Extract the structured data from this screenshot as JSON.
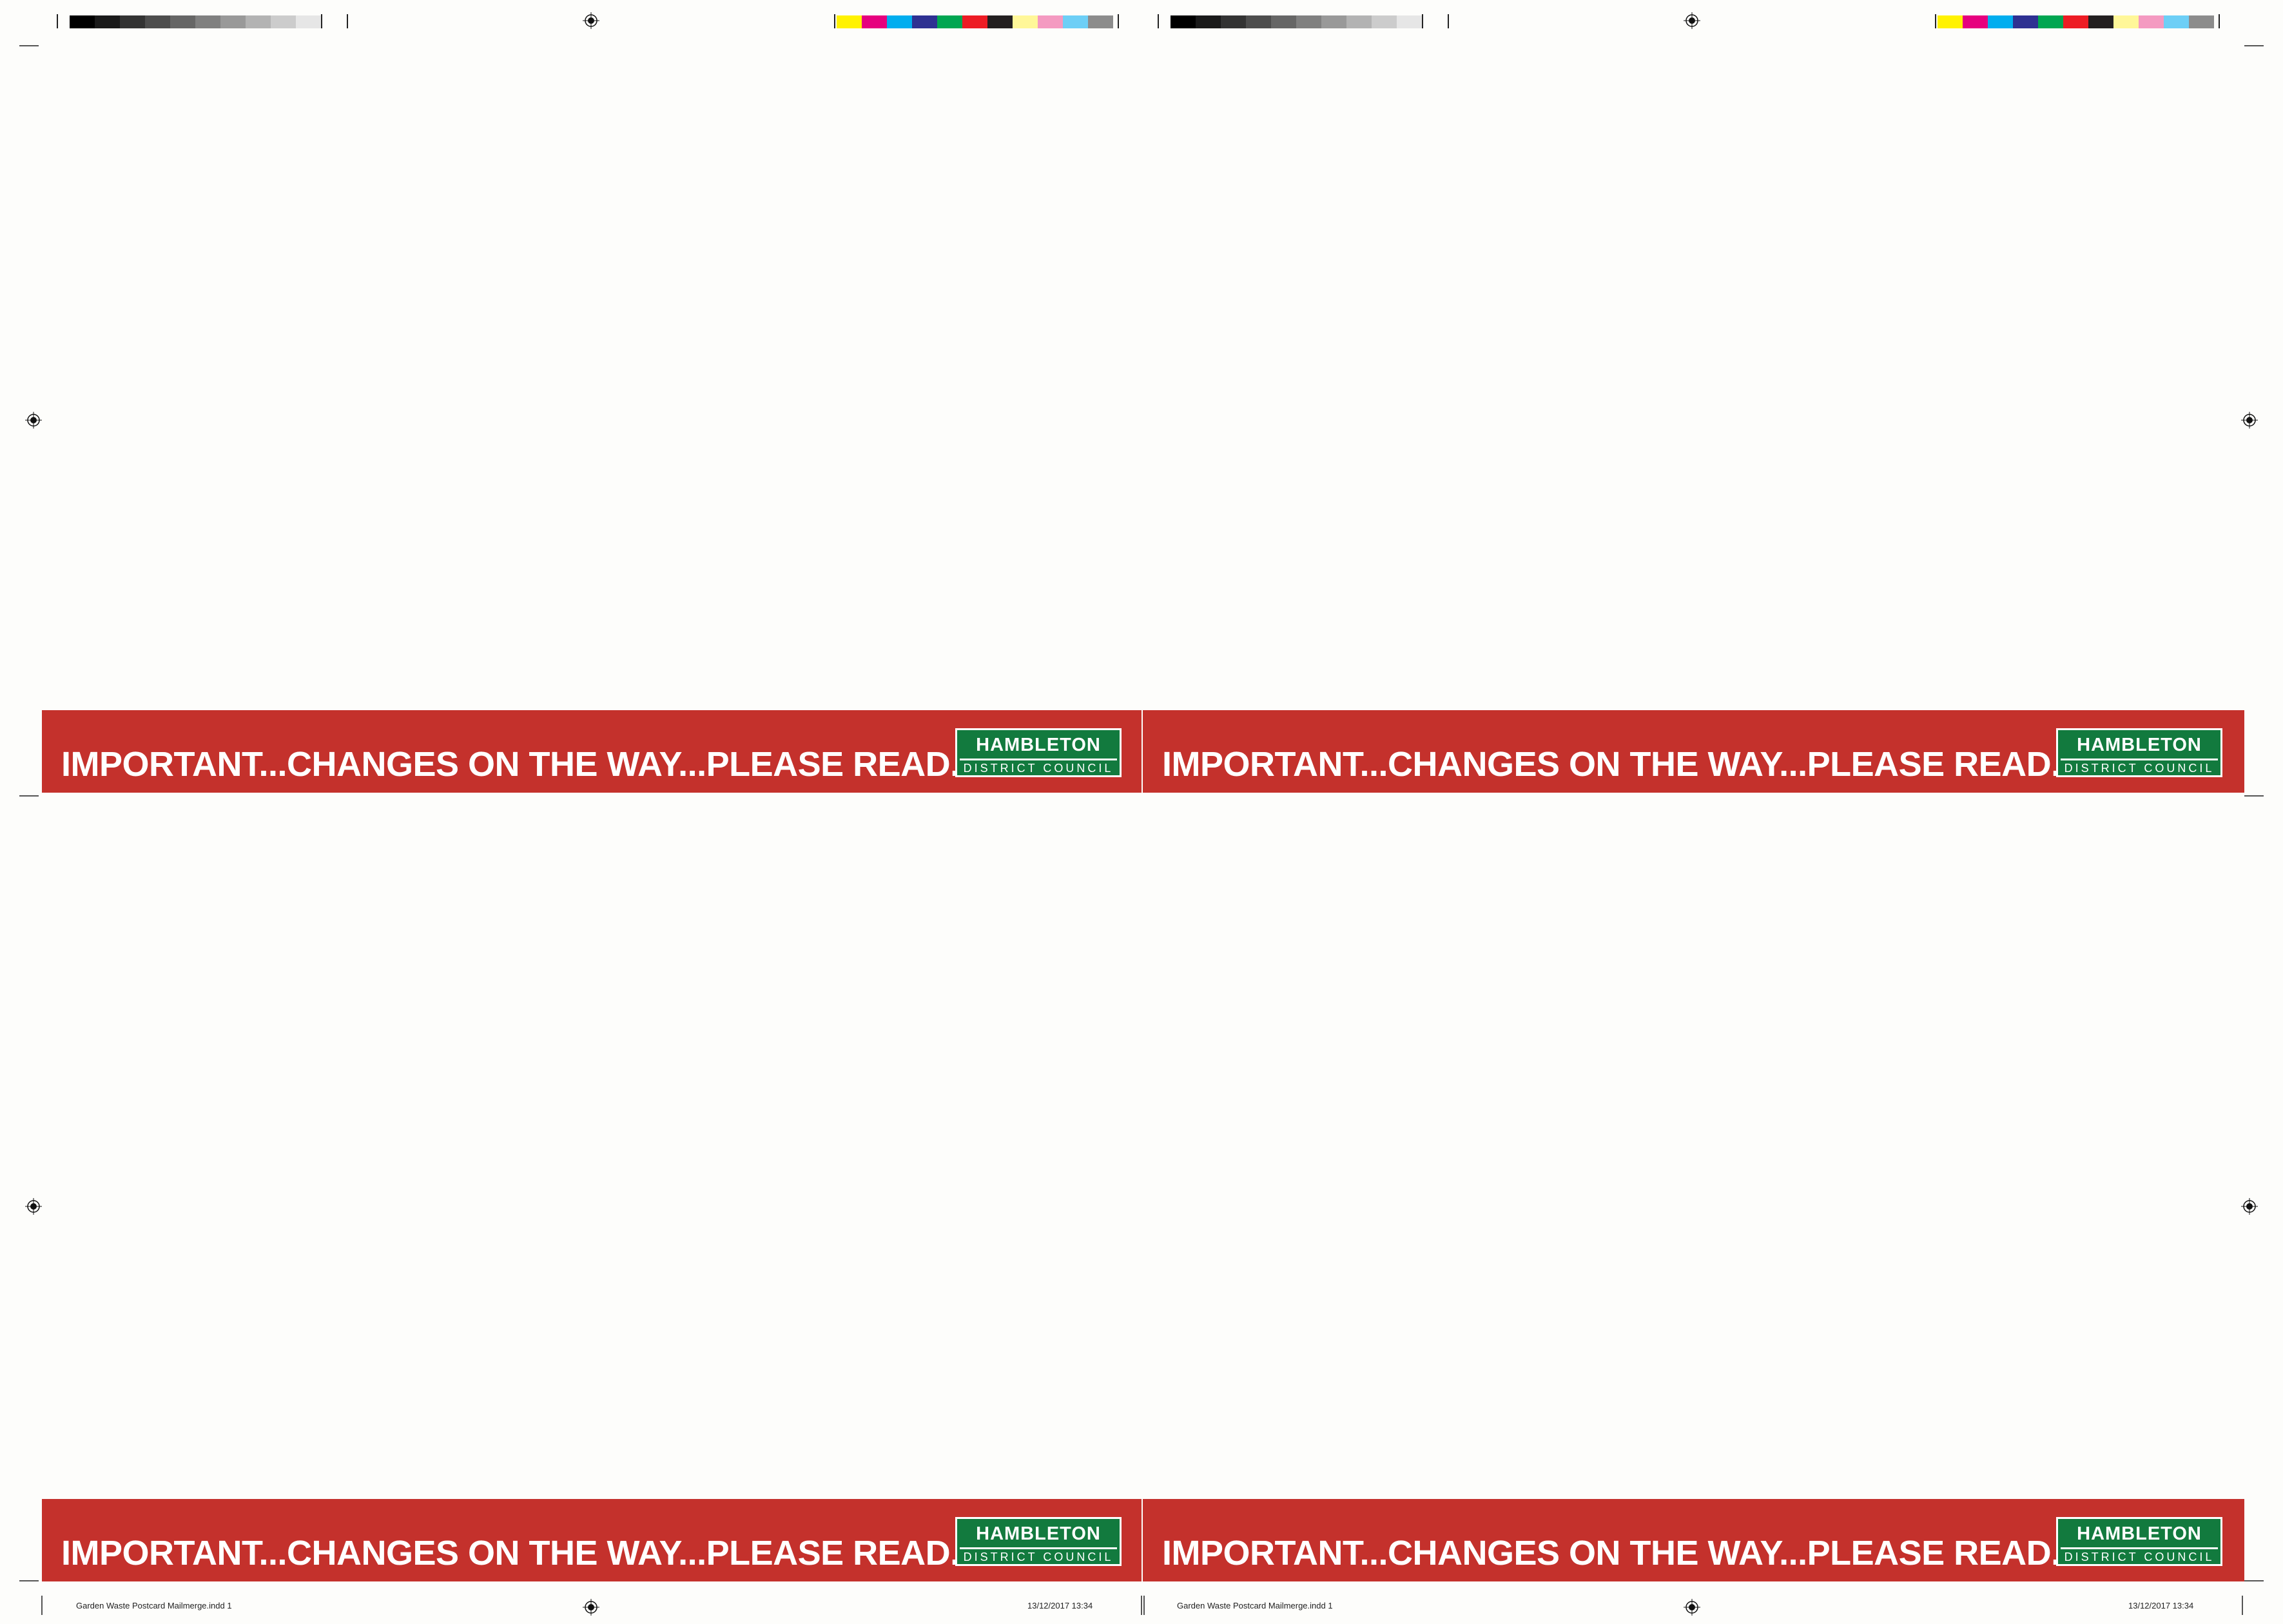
{
  "cards": [
    {
      "headline": "IMPORTANT...CHANGES ON THE WAY...PLEASE READ...",
      "logo_line1": "HAMBLETON",
      "logo_line2": "DISTRICT COUNCIL"
    },
    {
      "headline": "IMPORTANT...CHANGES ON THE WAY...PLEASE READ...",
      "logo_line1": "HAMBLETON",
      "logo_line2": "DISTRICT COUNCIL"
    },
    {
      "headline": "IMPORTANT...CHANGES ON THE WAY...PLEASE READ...",
      "logo_line1": "HAMBLETON",
      "logo_line2": "DISTRICT COUNCIL"
    },
    {
      "headline": "IMPORTANT...CHANGES ON THE WAY...PLEASE READ...",
      "logo_line1": "HAMBLETON",
      "logo_line2": "DISTRICT COUNCIL"
    }
  ],
  "slugs": [
    {
      "file": "Garden Waste Postcard Mailmerge.indd   1",
      "date": "13/12/2017   13:34"
    },
    {
      "file": "Garden Waste Postcard Mailmerge.indd   1",
      "date": "13/12/2017   13:34"
    }
  ],
  "colors": {
    "banner": "#c4312c",
    "logo_green": "#127a3e",
    "grey_swatches": [
      "#000000",
      "#1a1a1a",
      "#333333",
      "#4d4d4d",
      "#666666",
      "#808080",
      "#999999",
      "#b3b3b3",
      "#cccccc",
      "#e6e6e6"
    ],
    "color_swatches": [
      "#fff200",
      "#e6007e",
      "#00aeef",
      "#2e3192",
      "#00a651",
      "#ed1c24",
      "#231f20",
      "#fff799",
      "#f49ac1",
      "#6dcff6",
      "#8c8c8c"
    ]
  }
}
